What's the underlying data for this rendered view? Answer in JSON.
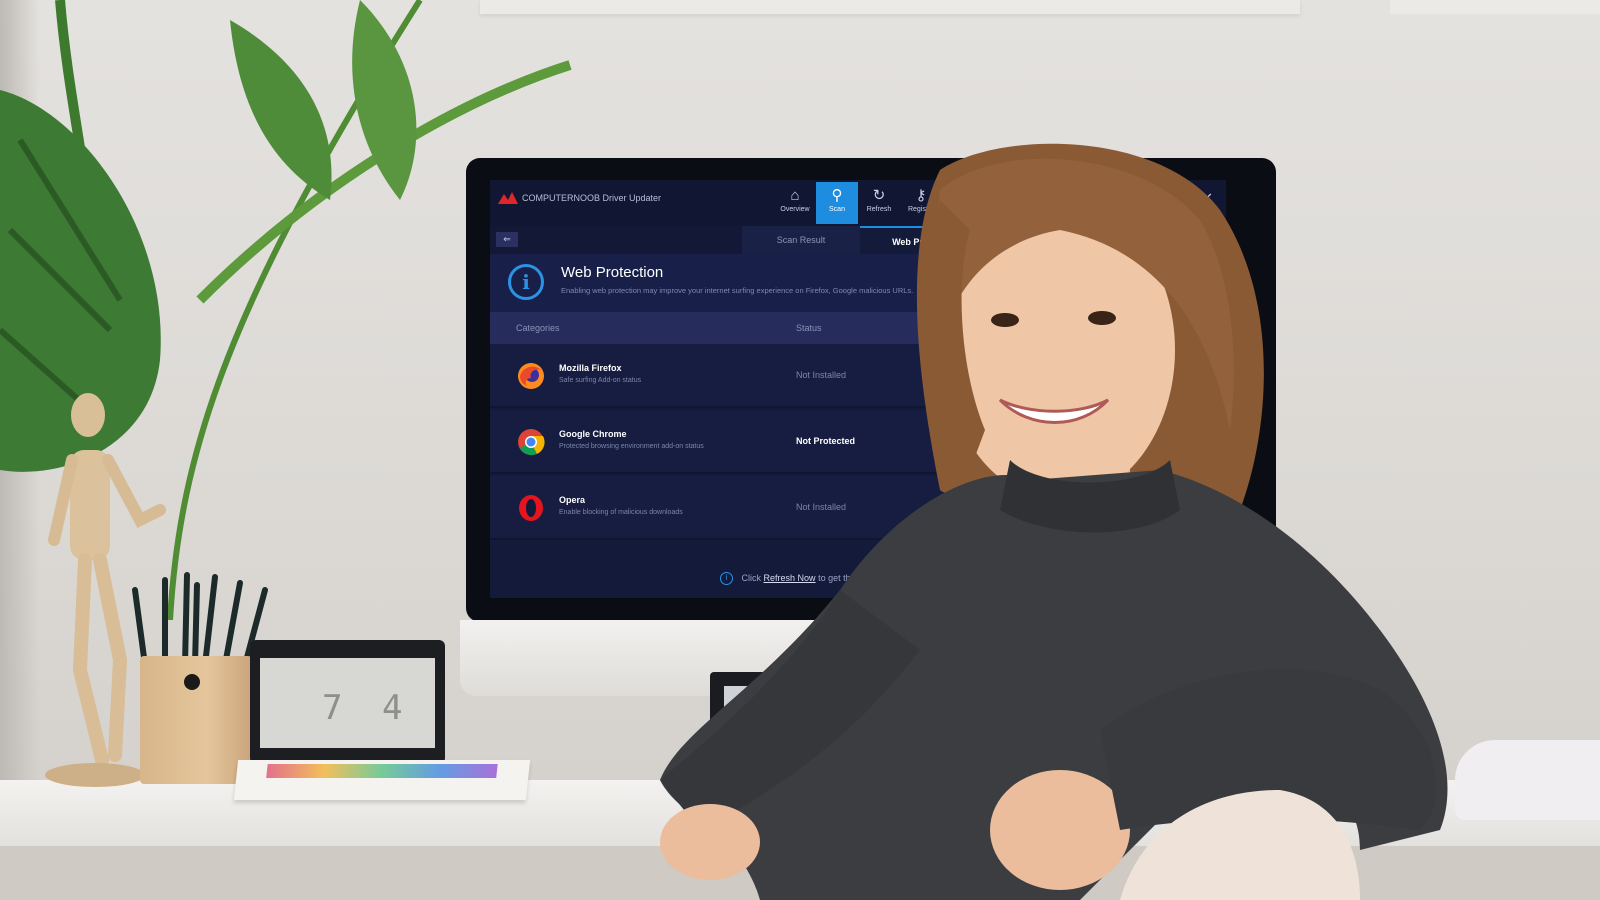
{
  "app": {
    "title": "COMPUTERNOOB Driver Updater",
    "nav": [
      {
        "label": "Overview",
        "icon": "home-icon",
        "glyph": "⌂"
      },
      {
        "label": "Scan",
        "icon": "search-icon",
        "glyph": "⚲"
      },
      {
        "label": "Refresh",
        "icon": "refresh-icon",
        "glyph": "↻"
      },
      {
        "label": "Register",
        "icon": "key-icon",
        "glyph": "⚷"
      }
    ],
    "window_controls": {
      "restore": "▫",
      "close": "✕"
    },
    "back": "⇐",
    "tabs": {
      "scan_result": "Scan Result",
      "web_protection": "Web Protection"
    },
    "banner": {
      "title": "Web Protection",
      "description": "Enabling web protection may improve your internet surfing experience on Firefox, Google malicious URLs."
    },
    "table": {
      "header_categories": "Categories",
      "header_status": "Status",
      "rows": [
        {
          "name": "Mozilla Firefox",
          "sub": "Safe surfing Add-on status",
          "status": "Not Installed",
          "icon": "firefox-icon"
        },
        {
          "name": "Google Chrome",
          "sub": "Protected browsing environment add-on status",
          "status": "Not Protected",
          "icon": "chrome-icon"
        },
        {
          "name": "Opera",
          "sub": "Enable blocking of malicious downloads",
          "status": "Not Installed",
          "icon": "opera-icon"
        }
      ]
    },
    "footer": {
      "prefix": "Click",
      "link": "Refresh Now",
      "suffix": "to get the current extension st"
    }
  },
  "desk_clock": {
    "digit1": "7",
    "digit2": "4"
  },
  "colors": {
    "accent": "#1e8de0",
    "app_bg": "#141a3a",
    "brand_red": "#e0262b"
  }
}
